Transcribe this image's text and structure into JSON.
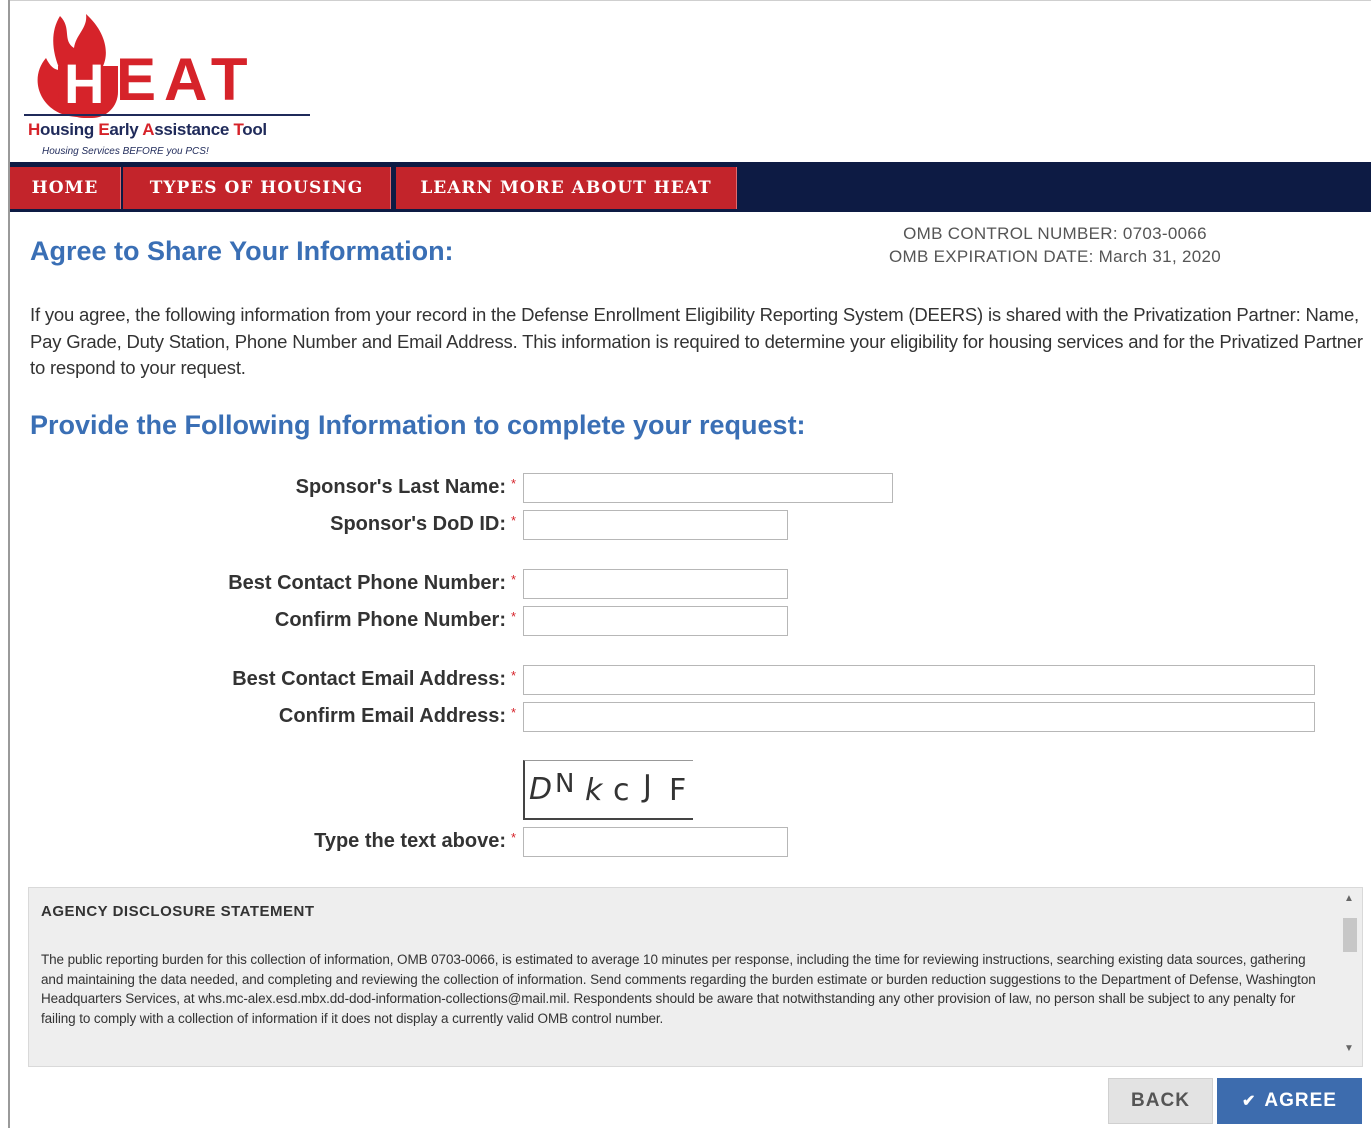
{
  "logo": {
    "word": "EAT",
    "initial": "H",
    "tagline_parts": [
      {
        "text": "H",
        "red": true
      },
      {
        "text": "ousing ",
        "red": false
      },
      {
        "text": "E",
        "red": true
      },
      {
        "text": "arly ",
        "red": false
      },
      {
        "text": "A",
        "red": true
      },
      {
        "text": "ssistance ",
        "red": false
      },
      {
        "text": "T",
        "red": true
      },
      {
        "text": "ool",
        "red": false
      }
    ],
    "subtag": "Housing Services BEFORE you PCS!",
    "colors": {
      "red": "#d6232a",
      "navy": "#1f2a5a"
    }
  },
  "nav": {
    "items": [
      {
        "label": "HOME"
      },
      {
        "label": "TYPES OF HOUSING"
      },
      {
        "label": "LEARN MORE ABOUT HEAT"
      }
    ],
    "colors": {
      "bar": "#0d1b44",
      "item": "#c3242b"
    }
  },
  "header": {
    "title": "Agree to Share Your Information:",
    "omb_control": "OMB CONTROL NUMBER: 0703-0066",
    "omb_expiration": "OMB EXPIRATION DATE: March 31, 2020"
  },
  "intro": "If you agree, the following information from your record in the Defense Enrollment Eligibility Reporting System (DEERS) is shared with the Privatization Partner: Name, Pay Grade, Duty Station, Phone Number and Email Address. This information is required to determine your eligibility for housing services and for the Privatized Partner to respond to your request.",
  "form": {
    "title": "Provide the Following Information to complete your request:",
    "required_mark": "*",
    "fields": {
      "last_name": {
        "label": "Sponsor's Last Name:",
        "value": ""
      },
      "dod_id": {
        "label": "Sponsor's DoD ID:",
        "value": ""
      },
      "phone": {
        "label": "Best Contact Phone Number:",
        "value": ""
      },
      "confirm_phone": {
        "label": "Confirm Phone Number:",
        "value": ""
      },
      "email": {
        "label": "Best Contact Email Address:",
        "value": ""
      },
      "confirm_email": {
        "label": "Confirm Email Address:",
        "value": ""
      },
      "captcha_input": {
        "label": "Type the text above:",
        "value": ""
      }
    },
    "captcha_chars": [
      "D",
      "N",
      "k",
      "c",
      "J",
      "F"
    ]
  },
  "disclosure": {
    "title": "AGENCY DISCLOSURE STATEMENT",
    "body": "The public reporting burden for this collection of information, OMB 0703-0066, is estimated to average 10 minutes per response, including the time for reviewing instructions, searching existing data sources, gathering and maintaining the data needed, and completing and reviewing the collection of information. Send comments regarding the burden estimate or burden reduction suggestions to the Department of Defense, Washington Headquarters Services, at whs.mc-alex.esd.mbx.dd-dod-information-collections@mail.mil. Respondents should be aware that notwithstanding any other provision of law, no person shall be subject to any penalty for failing to comply with a collection of information if it does not display a currently valid OMB control number."
  },
  "actions": {
    "back_label": "BACK",
    "agree_label": "AGREE",
    "agree_icon": "✔"
  },
  "colors": {
    "heading_blue": "#3a6fb5",
    "button_blue": "#3d6cae",
    "required_red": "#d6232a"
  }
}
